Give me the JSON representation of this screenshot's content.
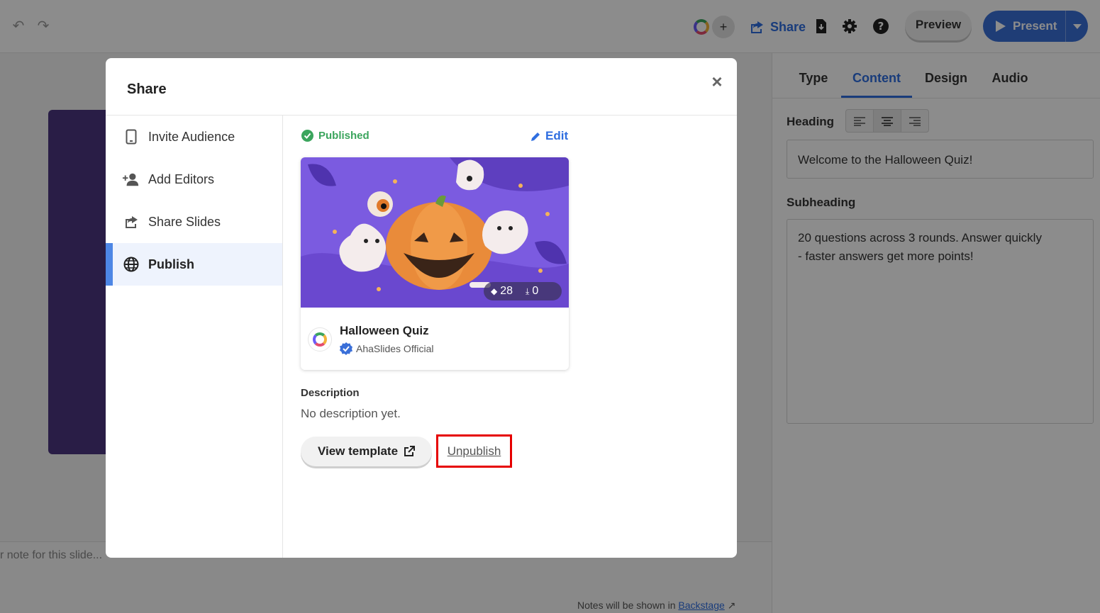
{
  "topbar": {
    "share_label": "Share",
    "preview_label": "Preview",
    "present_label": "Present",
    "add_icon": "+"
  },
  "right_panel": {
    "tabs": [
      {
        "label": "Type"
      },
      {
        "label": "Content",
        "active": true
      },
      {
        "label": "Design"
      },
      {
        "label": "Audio"
      }
    ],
    "heading_label": "Heading",
    "heading_value": "Welcome to the Halloween Quiz!",
    "subheading_label": "Subheading",
    "subheading_value": "20 questions across 3 rounds. Answer quickly\n- faster answers get more points!"
  },
  "notes": {
    "placeholder": "r note for this slide...",
    "hint_prefix": "Notes will be shown in ",
    "hint_link": "Backstage"
  },
  "modal": {
    "title": "Share",
    "close_icon": "×",
    "sidebar": [
      {
        "label": "Invite Audience",
        "icon": "tablet-icon"
      },
      {
        "label": "Add Editors",
        "icon": "user-plus-icon"
      },
      {
        "label": "Share Slides",
        "icon": "share-icon"
      },
      {
        "label": "Publish",
        "icon": "globe-icon",
        "active": true
      }
    ],
    "status": "Published",
    "edit_label": "Edit",
    "card": {
      "title": "Halloween Quiz",
      "author": "AhaSlides Official",
      "slides_count": "28",
      "downloads_count": "0"
    },
    "description_label": "Description",
    "description_text": "No description yet.",
    "view_template_label": "View template",
    "unpublish_label": "Unpublish"
  },
  "colors": {
    "accent": "#2f6ee0",
    "success": "#3ba55d",
    "highlight": "#e60000",
    "card_bg": "#7b5be0"
  }
}
